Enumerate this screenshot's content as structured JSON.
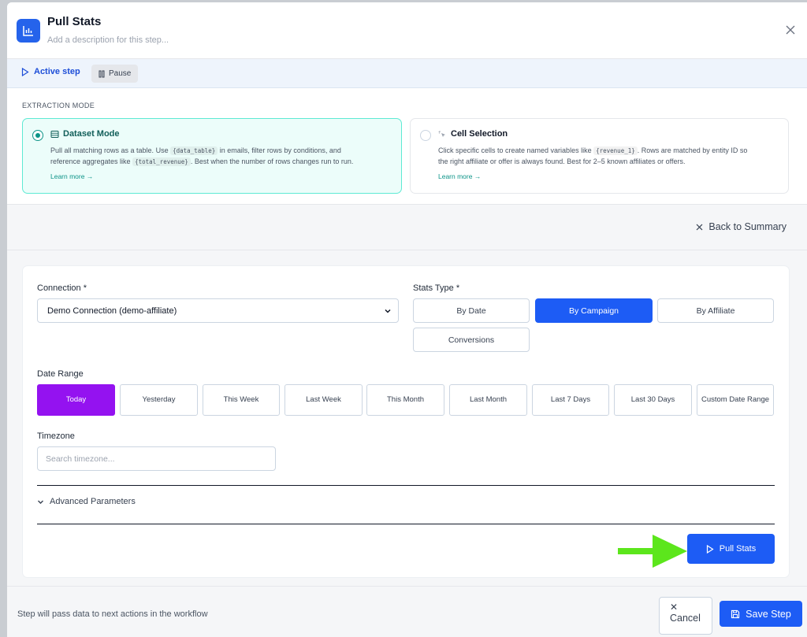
{
  "header": {
    "title": "Pull Stats",
    "description_placeholder": "Add a description for this step..."
  },
  "stepbar": {
    "active_label": "Active step",
    "pause_label": "Pause"
  },
  "extraction": {
    "section_label": "EXTRACTION MODE",
    "dataset": {
      "title": "Dataset Mode",
      "desc_1": "Pull all matching rows as a table. Use",
      "code_1": "{data_table}",
      "desc_2": "in emails, filter rows by conditions, and",
      "desc_3": "reference aggregates like",
      "code_2": "{total_revenue}",
      "desc_4": ". Best when the number of rows changes run to run.",
      "learn": "Learn more →",
      "selected": true
    },
    "cell": {
      "title": "Cell Selection",
      "desc_1": "Click specific cells to create named variables like",
      "code_1": "{revenue_1}",
      "desc_2": ". Rows are matched by entity ID so",
      "desc_3": "the right affiliate or offer is always found. Best for 2–5 known affiliates or offers.",
      "learn": "Learn more →",
      "selected": false
    }
  },
  "back_label": "Back to Summary",
  "form": {
    "connection_label": "Connection *",
    "connection_value": "Demo Connection (demo-affiliate)",
    "stats_type_label": "Stats Type *",
    "stats_types": [
      "By Date",
      "By Campaign",
      "By Affiliate",
      "Conversions"
    ],
    "stats_type_selected": "By Campaign",
    "date_range_label": "Date Range",
    "date_ranges": [
      "Today",
      "Yesterday",
      "This Week",
      "Last Week",
      "This Month",
      "Last Month",
      "Last 7 Days",
      "Last 30 Days",
      "Custom Date Range"
    ],
    "date_range_selected": "Today",
    "timezone_label": "Timezone",
    "timezone_placeholder": "Search timezone...",
    "advanced_label": "Advanced Parameters",
    "pull_label": "Pull Stats"
  },
  "footer": {
    "info": "Step will pass data to next actions in the workflow",
    "cancel_label": "Cancel",
    "save_label": "Save Step"
  },
  "colors": {
    "primary": "#1d5cf5",
    "today": "#9412f0",
    "teal": "#0d9488",
    "annotation_arrow": "#5ce61c"
  }
}
